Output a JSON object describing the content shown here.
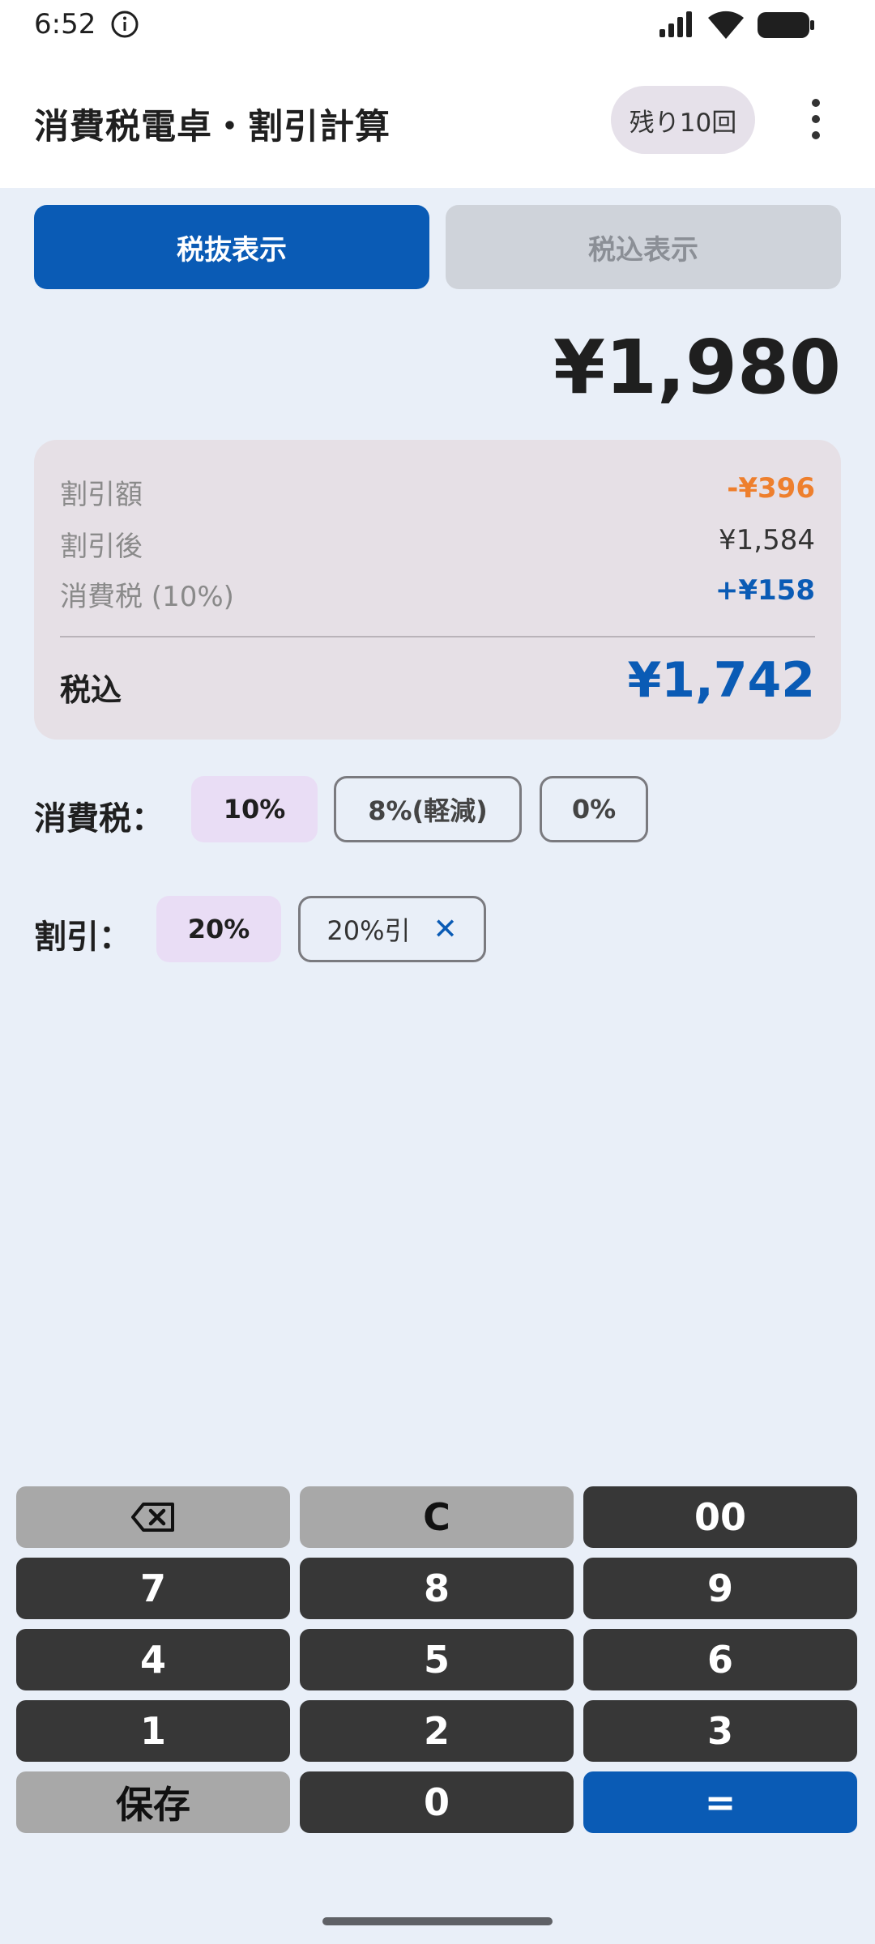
{
  "status_bar": {
    "time": "6:52",
    "icons": [
      "info-icon",
      "signal-icon",
      "wifi-icon",
      "battery-icon"
    ]
  },
  "app_bar": {
    "title": "消費税電卓・割引計算",
    "remaining": "残り10回",
    "menu_icon": "more-vert-icon"
  },
  "mode_toggle": {
    "excluded": "税抜表示",
    "included": "税込表示",
    "active": "excluded"
  },
  "main_amount": "¥1,980",
  "summary": {
    "discount_label": "割引額",
    "discount_value": "-¥396",
    "after_label": "割引後",
    "after_value": "¥1,584",
    "tax_label": "消費税 (10%)",
    "tax_value": "+¥158",
    "total_label": "税込",
    "total_value": "¥1,742"
  },
  "tax_row": {
    "label": "消費税：",
    "options": [
      "10%",
      "8%(軽減)",
      "0%"
    ],
    "selected": "10%"
  },
  "discount_row": {
    "label": "割引：",
    "selected": "20%",
    "applied": "20%引",
    "clear_icon": "close-icon"
  },
  "keypad": {
    "backspace_icon": "backspace-icon",
    "clear": "C",
    "double_zero": "00",
    "seven": "7",
    "eight": "8",
    "nine": "9",
    "four": "4",
    "five": "5",
    "six": "6",
    "one": "1",
    "two": "2",
    "three": "3",
    "save": "保存",
    "zero": "0",
    "equals": "="
  },
  "colors": {
    "accent": "#0a5bb5",
    "discount": "#ee7f2d",
    "key_dark": "#373737",
    "key_gray": "#a8a8a8",
    "background": "#e9eff8"
  }
}
